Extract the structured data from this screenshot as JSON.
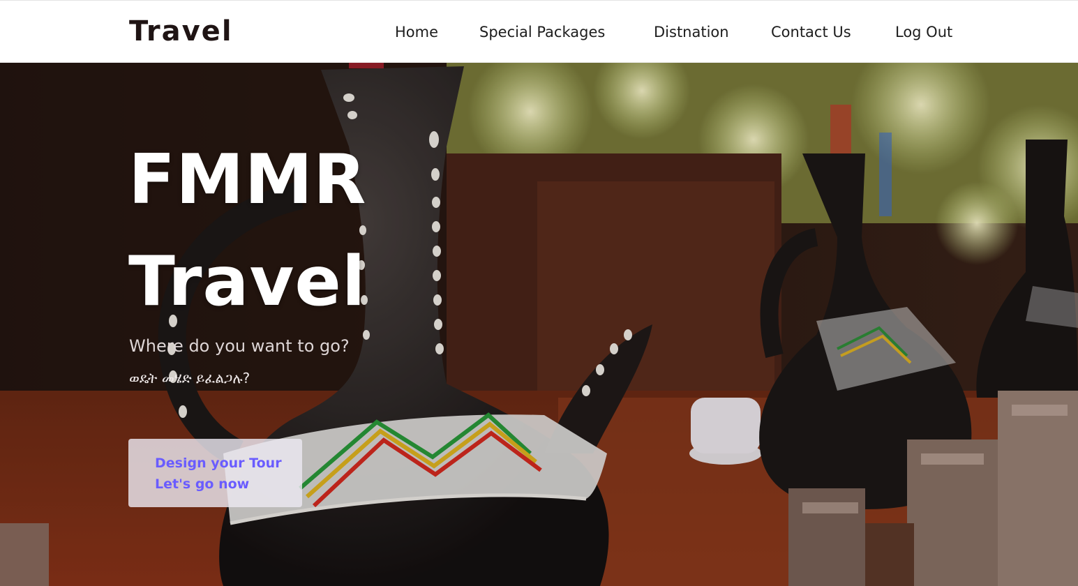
{
  "navbar": {
    "brand": "Travel",
    "items": [
      {
        "label": "Home"
      },
      {
        "label": "Special Packages"
      },
      {
        "label": "Distnation"
      },
      {
        "label": "Contact Us"
      },
      {
        "label": "Log Out"
      }
    ]
  },
  "hero": {
    "title_line1": "FMMR",
    "title_line2": "Travel",
    "subtitle": "Where do you want to go?",
    "subtitle_amharic": "ወዴት መሄድ ይፈልጋሉ?",
    "cta_line1": "Design your Tour",
    "cta_line2": "Let's go now",
    "background_image": "jebena-coffee-pots",
    "colors": {
      "cta_text": "#6a5cff",
      "cta_bg": "#ebe8f0",
      "title": "#ffffff"
    }
  }
}
